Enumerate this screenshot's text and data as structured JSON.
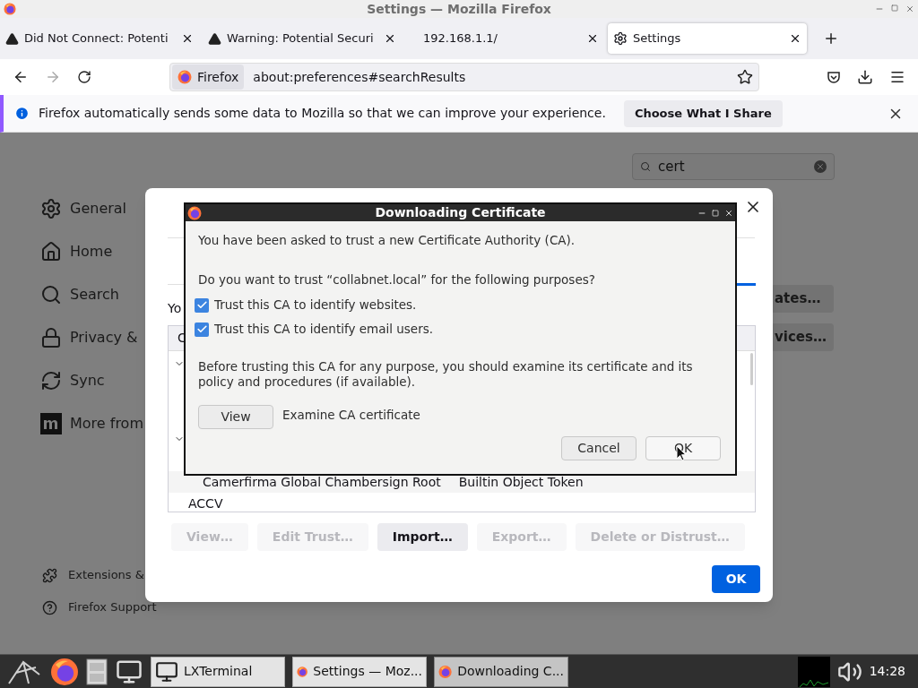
{
  "window": {
    "title": "Settings — Mozilla Firefox"
  },
  "tabs": [
    {
      "label": "Did Not Connect: Potenti",
      "selected": false
    },
    {
      "label": "Warning: Potential Securi",
      "selected": false
    },
    {
      "label": "192.168.1.1/",
      "selected": false
    },
    {
      "label": "Settings",
      "selected": true
    }
  ],
  "toolbar": {
    "identity": "Firefox",
    "url": "about:preferences#searchResults"
  },
  "notification": {
    "message": "Firefox automatically sends some data to Mozilla so that we can improve your experience.",
    "button": "Choose What I Share"
  },
  "settings": {
    "search": {
      "value": "cert"
    },
    "sidebar": [
      {
        "label": "General"
      },
      {
        "label": "Home"
      },
      {
        "label": "Search"
      },
      {
        "label": "Privacy &"
      },
      {
        "label": "Sync"
      },
      {
        "label": "More from"
      }
    ],
    "footer": [
      {
        "label": "Extensions &"
      },
      {
        "label": "Firefox Support"
      }
    ],
    "background_buttons": [
      "ates…",
      "vices…"
    ]
  },
  "certificate_manager": {
    "intro": "Yo",
    "column_1": "C",
    "rows": [
      {
        "kind": "cert",
        "name": "Camerfirma Global Chambersign Root",
        "token": "Builtin Object Token"
      },
      {
        "kind": "group",
        "name": "ACCV"
      }
    ],
    "buttons": [
      {
        "label": "View…",
        "disabled": true
      },
      {
        "label": "Edit Trust…",
        "disabled": true
      },
      {
        "label": "Import…",
        "disabled": false
      },
      {
        "label": "Export…",
        "disabled": true
      },
      {
        "label": "Delete or Distrust…",
        "disabled": true
      }
    ],
    "ok": "OK"
  },
  "download_dialog": {
    "title": "Downloading Certificate",
    "intro": "You have been asked to trust a new Certificate Authority (CA).",
    "question": "Do you want to trust “collabnet.local” for the following purposes?",
    "options": [
      {
        "label": "Trust this CA to identify websites.",
        "checked": true
      },
      {
        "label": "Trust this CA to identify email users.",
        "checked": true
      }
    ],
    "note": "Before trusting this CA for any purpose, you should examine its certificate and its policy and procedures (if available).",
    "view_button": "View",
    "view_label": "Examine CA certificate",
    "cancel": "Cancel",
    "ok": "OK"
  },
  "taskbar": {
    "tasks": [
      {
        "label": "LXTerminal",
        "selected": false
      },
      {
        "label": "Settings — Moz...",
        "selected": false
      },
      {
        "label": "Downloading C...",
        "selected": true
      }
    ],
    "clock": "14:28"
  }
}
